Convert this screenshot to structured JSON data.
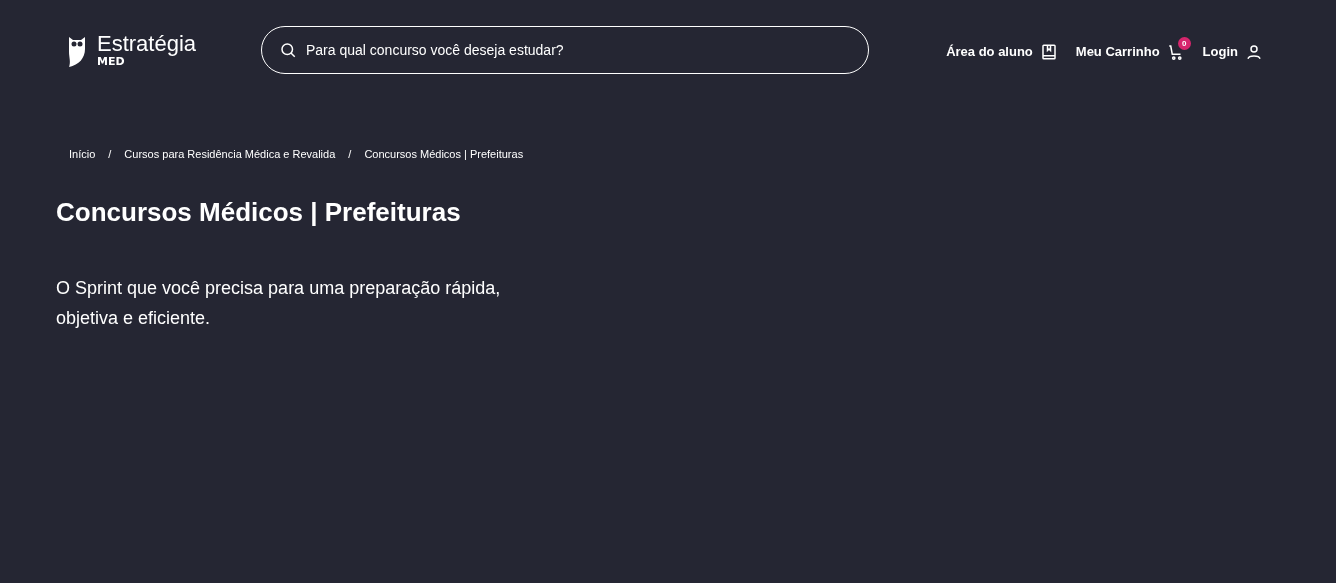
{
  "logo": {
    "name": "Estratégia",
    "sub": "MED"
  },
  "search": {
    "placeholder": "Para qual concurso você deseja estudar?"
  },
  "nav": [
    {
      "label": "Área do aluno",
      "kind": "book"
    },
    {
      "label": "Meu Carrinho",
      "kind": "cart",
      "badge": "0"
    },
    {
      "label": "Login",
      "kind": "user"
    }
  ],
  "breadcrumb": [
    {
      "label": "Início",
      "separator": "/"
    },
    {
      "label": "Cursos para Residência Médica e Revalida",
      "separator": "/"
    },
    {
      "label": "Concursos Médicos | Prefeituras"
    }
  ],
  "title": "Concursos Médicos | Prefeituras",
  "description": "O Sprint que você precisa para uma preparação rápida, objetiva e eficiente."
}
